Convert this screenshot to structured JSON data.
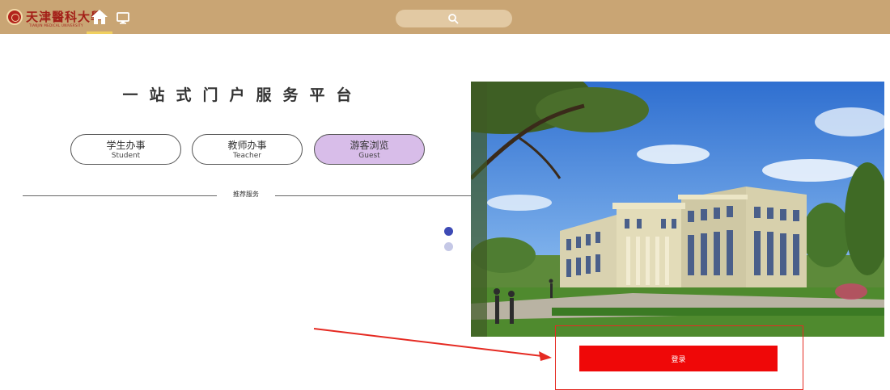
{
  "header": {
    "logo_title": "天津醫科大學",
    "logo_subtitle": "TIANJIN MEDICAL UNIVERSITY",
    "icons": [
      "seal-icon",
      "home-icon",
      "monitor-icon",
      "search-icon"
    ],
    "bar_color": "#c9a574"
  },
  "main": {
    "title": "一站式门户服务平台",
    "roles": [
      {
        "zh": "学生办事",
        "en": "Student",
        "active": false
      },
      {
        "zh": "教师办事",
        "en": "Teacher",
        "active": false
      },
      {
        "zh": "游客浏览",
        "en": "Guest",
        "active": true
      }
    ],
    "divider_label": "推荐服务",
    "carousel_pages": 2,
    "carousel_active": 1
  },
  "login": {
    "label": "登录",
    "color": "#ef0808"
  },
  "annotation_color": "#e52a22"
}
